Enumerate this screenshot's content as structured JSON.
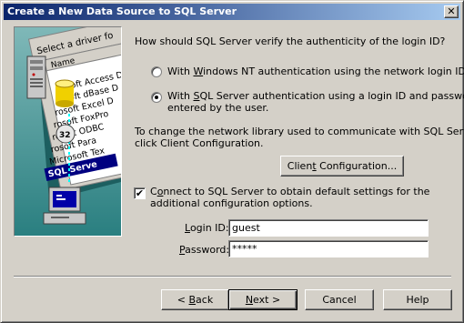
{
  "window": {
    "title": "Create a New Data Source to SQL Server",
    "close_glyph": "✕"
  },
  "wizard_image": {
    "dialog_caption": "Select a driver fo",
    "list_header": "Name",
    "list_items": [
      "rosoft Access D",
      "rosoft dBase D",
      "rosoft Excel D",
      "rosoft FoxPro",
      "rosoft ODBC",
      "rosoft Para",
      "Microsoft Tex",
      "SQL Serve"
    ],
    "badge": "32"
  },
  "main": {
    "question": "How should SQL Server verify the authenticity of the login ID?",
    "radio_windows": {
      "prefix": "With ",
      "hotkey": "W",
      "rest": "indows NT authentication using the network login ID.",
      "checked": false
    },
    "radio_sql": {
      "prefix": "With ",
      "hotkey": "S",
      "rest": "QL Server authentication using a login ID and password",
      "line2": "entered by the user.",
      "checked": true
    },
    "network_note_line1": "To change the network library used to communicate with SQL Server,",
    "network_note_line2": "click Client Configuration.",
    "client_config_button": {
      "prefix": "Clien",
      "hotkey": "t",
      "rest": " Configuration..."
    },
    "connect_checkbox": {
      "checked": true,
      "glyph": "✔",
      "prefix": "C",
      "hotkey": "o",
      "rest": "nnect to SQL Server to obtain default settings for the",
      "line2": "additional configuration options."
    },
    "login_label": {
      "hotkey": "L",
      "rest": "ogin ID:"
    },
    "login_value": "guest",
    "password_label": {
      "hotkey": "P",
      "rest": "assword:"
    },
    "password_value": "*****"
  },
  "footer": {
    "back": {
      "prefix": "< ",
      "hotkey": "B",
      "rest": "ack"
    },
    "next": {
      "hotkey": "N",
      "rest": "ext >"
    },
    "cancel": "Cancel",
    "help": "Help"
  },
  "colors": {
    "titlebar_start": "#0a246a",
    "titlebar_end": "#a6caf0",
    "dialog_face": "#d4d0c8"
  }
}
